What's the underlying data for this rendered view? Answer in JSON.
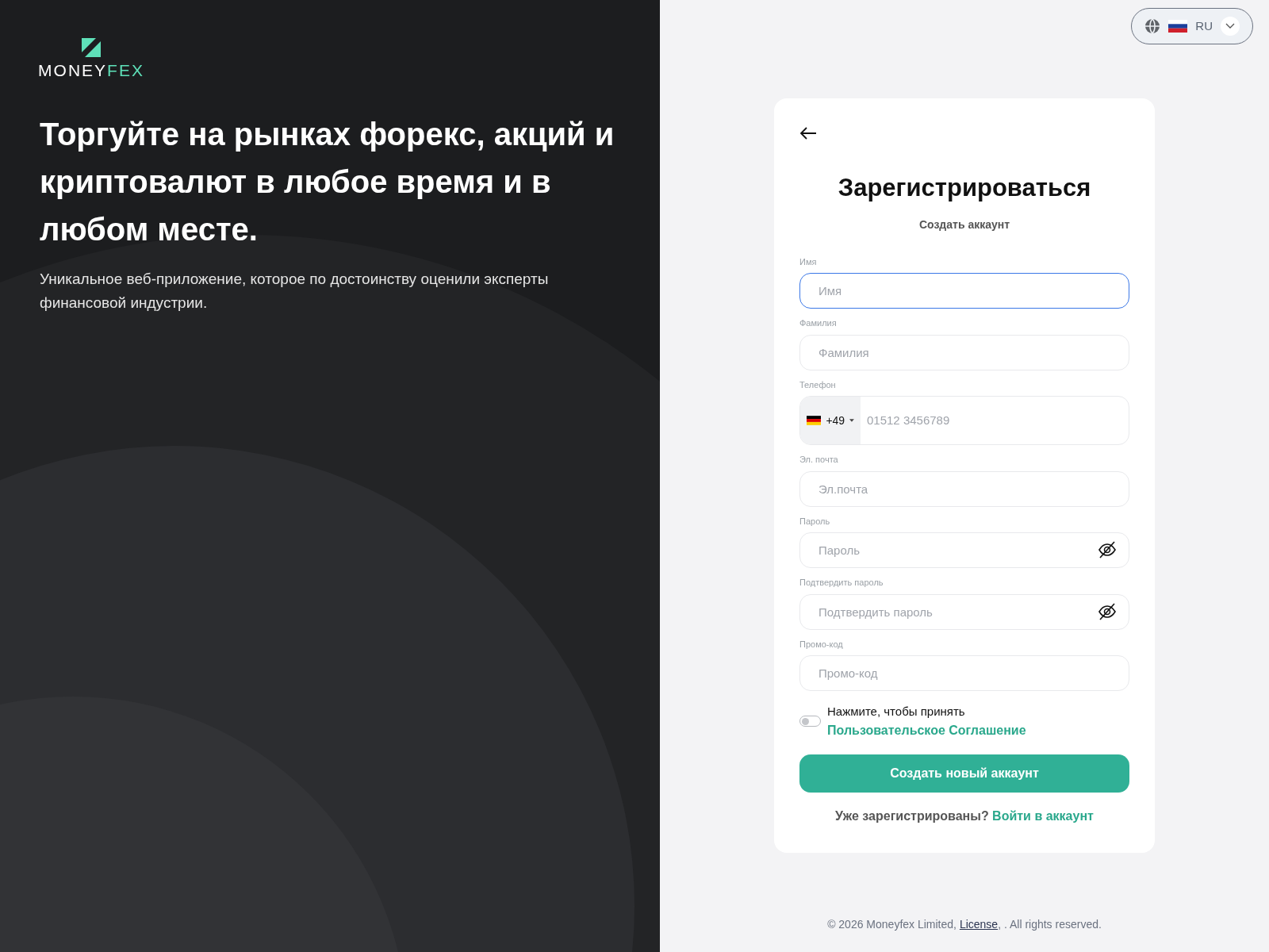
{
  "brand": {
    "logo_text": "MONEY",
    "logo_accent": "FEX"
  },
  "hero": {
    "headline": "Торгуйте на рынках форекс, акций и криптовалют в любое время и в любом месте.",
    "description": "Уникальное веб-приложение, которое по достоинству оценили эксперты финансовой индустрии."
  },
  "language_selector": {
    "code": "RU"
  },
  "form": {
    "title": "Зарегистрироваться",
    "subtitle": "Создать аккаунт",
    "fields": [
      {
        "kind": "text",
        "label": "Имя",
        "placeholder": "Имя",
        "focused": true
      },
      {
        "kind": "text",
        "label": "Фамилия",
        "placeholder": "Фамилия",
        "focused": false
      },
      {
        "kind": "phone",
        "label": "Телефон",
        "country_code": "+49",
        "placeholder": "01512 3456789",
        "focused": false
      },
      {
        "kind": "text",
        "label": "Эл. почта",
        "placeholder": "Эл.почта",
        "focused": false
      },
      {
        "kind": "password",
        "label": "Пароль",
        "placeholder": "Пароль",
        "focused": false
      },
      {
        "kind": "password",
        "label": "Подтвердить пароль",
        "placeholder": "Подтвердить пароль",
        "focused": false
      },
      {
        "kind": "text",
        "label": "Промо-код",
        "placeholder": "Промо-код",
        "focused": false
      }
    ],
    "agreement": {
      "on": false,
      "text": "Нажмите, чтобы принять",
      "link": "Пользовательское Соглашение"
    },
    "submit": "Создать новый аккаунт",
    "login_prompt": {
      "text": "Уже зарегистрированы?",
      "link": "Войти в аккаунт"
    }
  },
  "footer": {
    "before": "© 2026 Moneyfex Limited,",
    "link": "License",
    "after": ", . All rights reserved."
  }
}
